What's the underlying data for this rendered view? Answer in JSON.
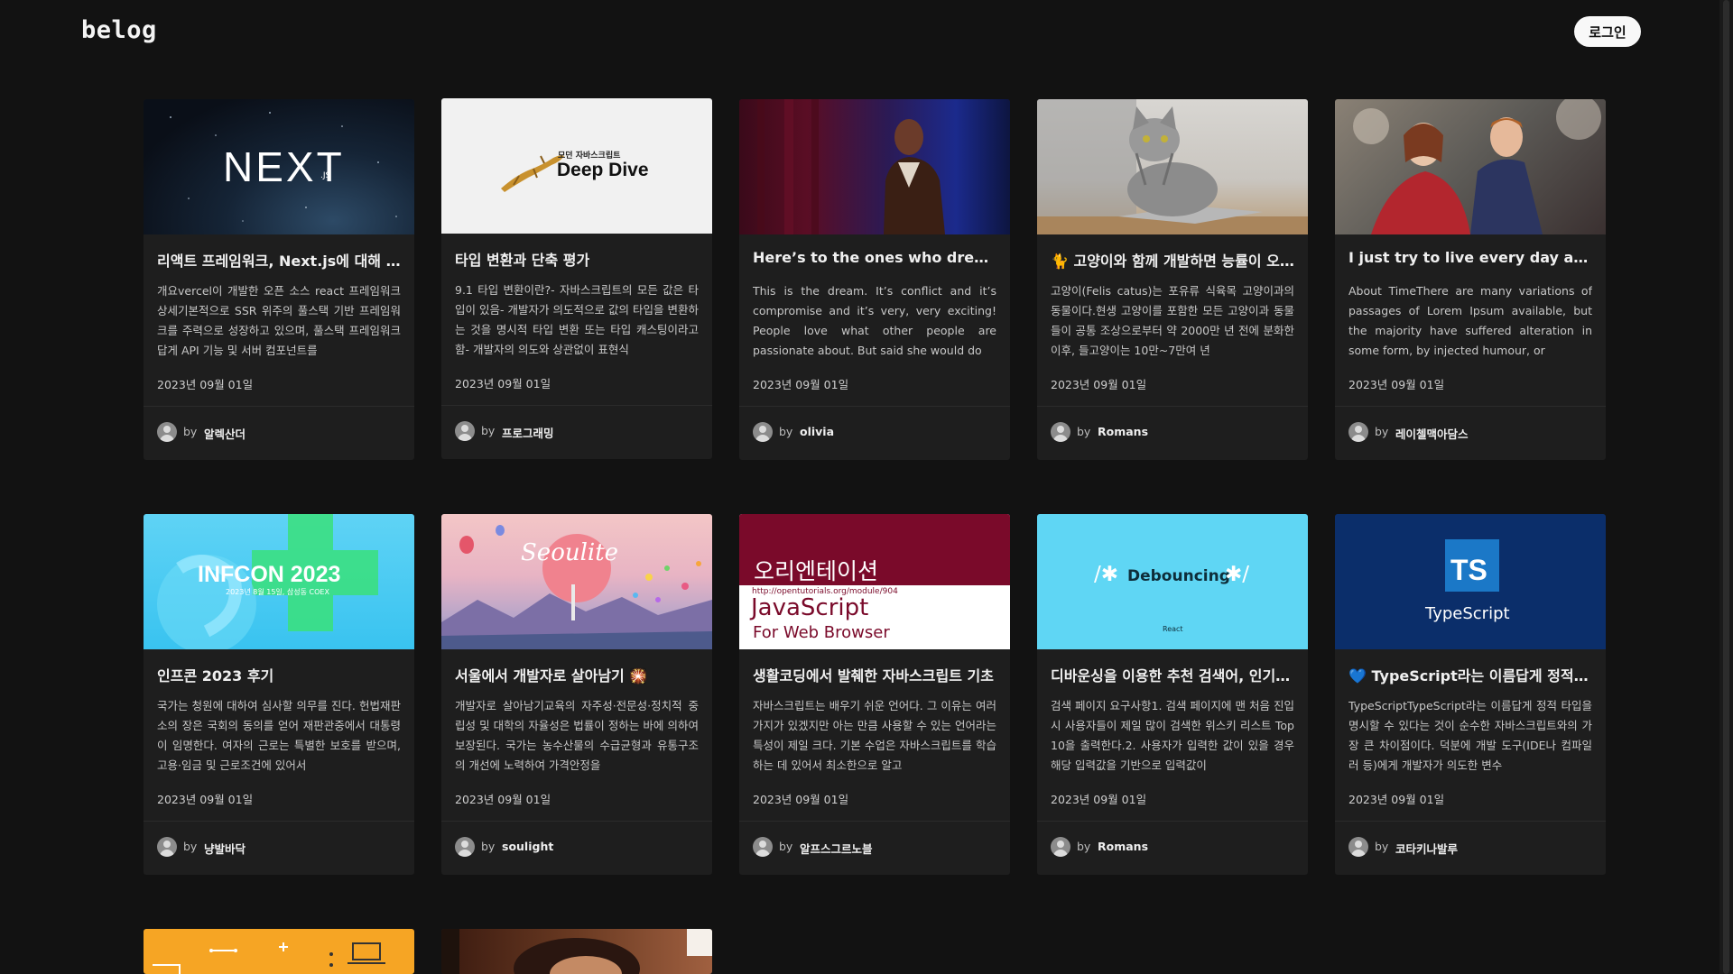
{
  "header": {
    "logo": "belog",
    "login_label": "로그인"
  },
  "posts": [
    {
      "title": "리액트 프레임워크, Next.js에 대해 알아보자",
      "desc": "개요vercel이 개발한 오픈 소스 react 프레임워크 상세기본적으로 SSR 위주의 풀스택 기반 프레임워크를 주력으로 성장하고 있으며, 풀스택 프레임워크답게 API 기능 및 서버 컴포넌트를",
      "date": "2023년 09월 01일",
      "by": "by",
      "author": "알렉산더",
      "thumb": {
        "logo_text": "NEXT",
        "sub_text": ".JS"
      }
    },
    {
      "title": "타입 변환과 단축 평가",
      "desc": "9.1 타입 변환이란?- 자바스크립트의 모든 값은 타입이 있음- 개발자가 의도적으로 값의 타입을 변환하는 것을 명시적 타입 변환 또는 타입 캐스팅이라고 함- 개발자의 의도와 상관없이 표현식",
      "date": "2023년 09월 01일",
      "by": "by",
      "author": "프로그래밍",
      "thumb": {
        "small_text": "모던 자바스크립트",
        "big_text": "Deep Dive"
      }
    },
    {
      "title": "Here’s to the ones who dream, foolish as they may seem",
      "desc": "This is the dream. It’s conflict and it’s compromise and it’s very, very exciting! People love what other people are passionate about. But said she would do",
      "date": "2023년 09월 01일",
      "by": "by",
      "author": "olivia",
      "thumb": {}
    },
    {
      "title": "🐈 고양이와 함께 개발하면 능률이 오를까",
      "desc": "고양이(Felis catus)는 포유류 식육목 고양이과의 동물이다.현생 고양이를 포함한 모든 고양이과 동물들이 공통 조상으로부터 약 2000만 년 전에 분화한 이후, 들고양이는 10만~7만여 년",
      "date": "2023년 09월 01일",
      "by": "by",
      "author": "Romans",
      "thumb": {}
    },
    {
      "title": "I just try to live every day as if I've deliberately come back",
      "desc": "About TimeThere are many variations of passages of Lorem Ipsum available, but the majority have suffered alteration in some form, by injected humour, or",
      "date": "2023년 09월 01일",
      "by": "by",
      "author": "레이첼맥아담스",
      "thumb": {}
    },
    {
      "title": "인프콘 2023 후기",
      "desc": "국가는 청원에 대하여 심사할 의무를 진다. 헌법재판소의 장은 국회의 동의를 얻어 재판관중에서 대통령이 임명한다. 여자의 근로는 특별한 보호를 받으며, 고용·임금 및 근로조건에 있어서",
      "date": "2023년 09월 01일",
      "by": "by",
      "author": "냥발바닥",
      "thumb": {
        "big_text": "INFCON 2023",
        "small_text": "2023년 8월 15일, 삼성동 COEX"
      }
    },
    {
      "title": "서울에서 개발자로 살아남기 🎇",
      "desc": "개발자로 살아남기교육의 자주성·전문성·정치적 중립성 및 대학의 자율성은 법률이 정하는 바에 의하여 보장된다. 국가는 농수산물의 수급균형과 유통구조의 개선에 노력하여 가격안정을",
      "date": "2023년 09월 01일",
      "by": "by",
      "author": "soulight",
      "thumb": {
        "script_text": "Seoulite"
      }
    },
    {
      "title": "생활코딩에서 발췌한 자바스크립트 기초",
      "desc": "자바스크립트는 배우기 쉬운 언어다. 그 이유는 여러 가지가 있겠지만 아는 만큼 사용할 수 있는 언어라는 특성이 제일 크다. 기본 수업은 자바스크립트를 학습하는 데 있어서 최소한으로 알고",
      "date": "2023년 09월 01일",
      "by": "by",
      "author": "알프스그르노블",
      "thumb": {
        "top_text": "오리엔테이션",
        "url_text": "http://opentutorials.org/module/904",
        "big_text": "JavaScript",
        "sub_text": "For Web Browser"
      }
    },
    {
      "title": "디바운싱을 이용한 추천 검색어, 인기 검색어",
      "desc": "검색 페이지 요구사항1. 검색 페이지에 맨 처음 진입 시 사용자들이 제일 많이 검색한 위스키 리스트 Top 10을 출력한다.2. 사용자가 입력한 값이 있을 경우 해당 입력값을 기반으로 입력값이",
      "date": "2023년 09월 01일",
      "by": "by",
      "author": "Romans",
      "thumb": {
        "big_text": "Debouncing",
        "small_text": "React"
      }
    },
    {
      "title": "💙 TypeScript라는 이름답게 정적 타입을 명시",
      "desc": "TypeScriptTypeScript라는 이름답게 정적 타입을 명시할 수 있다는 것이 순수한 자바스크립트와의 가장 큰 차이점이다. 덕분에 개발 도구(IDE나 컴파일러 등)에게 개발자가 의도한 변수",
      "date": "2023년 09월 01일",
      "by": "by",
      "author": "코타키나발루",
      "thumb": {
        "badge_text": "TS",
        "big_text": "TypeScript"
      }
    },
    {
      "title": "",
      "desc": "",
      "date": "",
      "by": "",
      "author": "",
      "thumb": {}
    },
    {
      "title": "",
      "desc": "",
      "date": "",
      "by": "",
      "author": "",
      "thumb": {}
    }
  ]
}
